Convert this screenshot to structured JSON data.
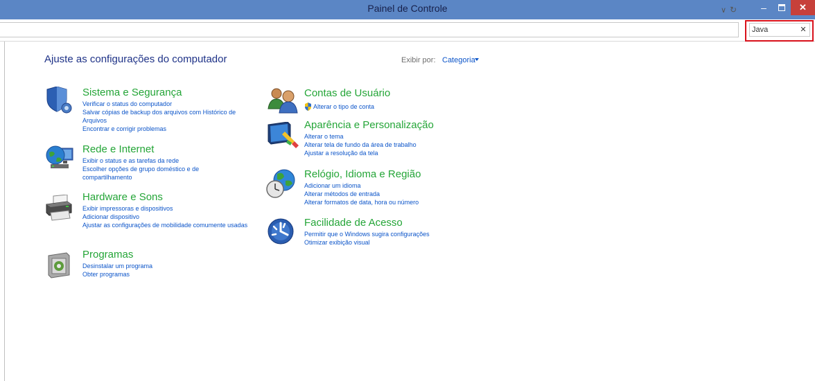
{
  "window": {
    "title": "Painel de Controle",
    "minimize_glyph": "–",
    "close_glyph": "✕"
  },
  "address_bar": {
    "dropdown_glyph": "∨",
    "refresh_glyph": "↻"
  },
  "search": {
    "value": "Java",
    "clear_glyph": "✕"
  },
  "page": {
    "heading": "Ajuste as configurações do computador",
    "view_by_label": "Exibir por:",
    "view_by_value": "Categoria"
  },
  "categories": {
    "system": {
      "title": "Sistema e Segurança",
      "icon": "shield-icon",
      "links": [
        "Verificar o status do computador",
        "Salvar cópias de backup dos arquivos com Histórico de Arquivos",
        "Encontrar e corrigir problemas"
      ]
    },
    "network": {
      "title": "Rede e Internet",
      "icon": "network-globe-icon",
      "links": [
        "Exibir o status e as tarefas da rede",
        "Escolher opções de grupo doméstico e de compartilhamento"
      ]
    },
    "hardware": {
      "title": "Hardware e Sons",
      "icon": "printer-icon",
      "links": [
        "Exibir impressoras e dispositivos",
        "Adicionar dispositivo",
        "Ajustar as configurações de mobilidade comumente usadas"
      ]
    },
    "programs": {
      "title": "Programas",
      "icon": "programs-icon",
      "links": [
        "Desinstalar um programa",
        "Obter programas"
      ]
    },
    "accounts": {
      "title": "Contas de Usuário",
      "icon": "users-icon",
      "links": [
        "Alterar o tipo de conta"
      ]
    },
    "appearance": {
      "title": "Aparência e Personalização",
      "icon": "monitor-paint-icon",
      "links": [
        "Alterar o tema",
        "Alterar tela de fundo da área de trabalho",
        "Ajustar a resolução da tela"
      ]
    },
    "clock": {
      "title": "Relógio, Idioma e Região",
      "icon": "clock-globe-icon",
      "links": [
        "Adicionar um idioma",
        "Alterar métodos de entrada",
        "Alterar formatos de data, hora ou número"
      ]
    },
    "access": {
      "title": "Facilidade de Acesso",
      "icon": "ease-of-access-icon",
      "links": [
        "Permitir que o Windows sugira configurações",
        "Otimizar exibição visual"
      ]
    }
  },
  "colors": {
    "title_bar": "#5b86c5",
    "close_button": "#c7403a",
    "category_title": "#24a537",
    "link": "#0b54c9",
    "heading": "#1e3287",
    "search_highlight": "#d8101a"
  }
}
